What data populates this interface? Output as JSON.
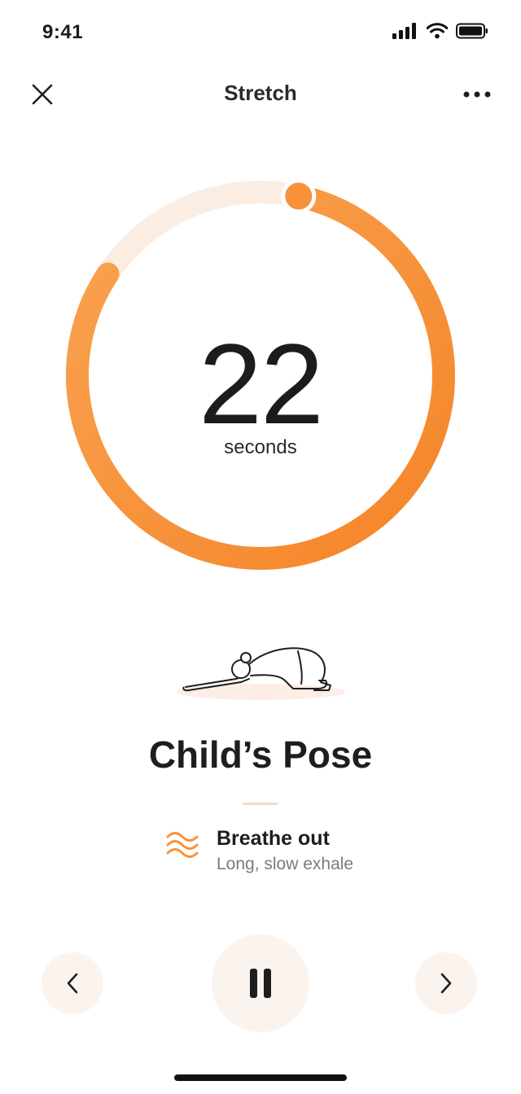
{
  "status_bar": {
    "time": "9:41",
    "icons": [
      "cellular-signal-icon",
      "wifi-icon",
      "battery-icon"
    ]
  },
  "nav": {
    "title": "Stretch",
    "close_icon": "close-icon",
    "more_icon": "more-horizontal-icon"
  },
  "timer": {
    "value": "22",
    "unit": "seconds",
    "progress_fraction": 0.81
  },
  "pose": {
    "name": "Child’s Pose",
    "illustration": "childs-pose-illustration"
  },
  "breathing": {
    "icon": "breath-waves-icon",
    "title": "Breathe out",
    "subtitle": "Long, slow exhale"
  },
  "controls": {
    "previous_icon": "chevron-left-icon",
    "pause_icon": "pause-icon",
    "next_icon": "chevron-right-icon"
  },
  "colors": {
    "accent": "#F7923A",
    "accent_dark": "#F58428",
    "track": "#FCEDE3",
    "control_bg": "#FBF3EE",
    "text": "#1B1B1B",
    "muted": "#7B7B7B"
  }
}
